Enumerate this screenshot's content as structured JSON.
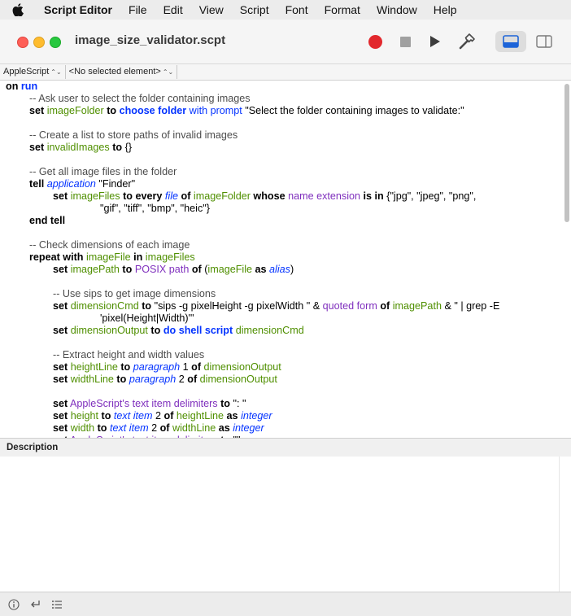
{
  "menubar": {
    "app_name": "Script Editor",
    "items": [
      "File",
      "Edit",
      "View",
      "Script",
      "Font",
      "Format",
      "Window",
      "Help"
    ]
  },
  "window": {
    "title": "image_size_validator.scpt"
  },
  "navbar": {
    "language": "AppleScript",
    "element": "<No selected element>"
  },
  "description": {
    "header": "Description",
    "text": ""
  },
  "code_lines": [
    {
      "indent": 0,
      "tokens": [
        {
          "t": "on",
          "c": "kw"
        },
        {
          "t": " "
        },
        {
          "t": "run",
          "c": "kwb"
        }
      ]
    },
    {
      "indent": 1,
      "tokens": [
        {
          "t": "-- Ask user to select the folder containing images",
          "c": "cmt"
        }
      ]
    },
    {
      "indent": 1,
      "tokens": [
        {
          "t": "set",
          "c": "kw"
        },
        {
          "t": " "
        },
        {
          "t": "imageFolder",
          "c": "var"
        },
        {
          "t": " "
        },
        {
          "t": "to",
          "c": "kw"
        },
        {
          "t": " "
        },
        {
          "t": "choose folder",
          "c": "kwb"
        },
        {
          "t": " "
        },
        {
          "t": "with prompt",
          "c": "cmd"
        },
        {
          "t": " \"Select the folder containing images to validate:\""
        }
      ]
    },
    {
      "indent": 0,
      "tokens": []
    },
    {
      "indent": 1,
      "tokens": [
        {
          "t": "-- Create a list to store paths of invalid images",
          "c": "cmt"
        }
      ]
    },
    {
      "indent": 1,
      "tokens": [
        {
          "t": "set",
          "c": "kw"
        },
        {
          "t": " "
        },
        {
          "t": "invalidImages",
          "c": "var"
        },
        {
          "t": " "
        },
        {
          "t": "to",
          "c": "kw"
        },
        {
          "t": " {}"
        }
      ]
    },
    {
      "indent": 0,
      "tokens": []
    },
    {
      "indent": 1,
      "tokens": [
        {
          "t": "-- Get all image files in the folder",
          "c": "cmt"
        }
      ]
    },
    {
      "indent": 1,
      "tokens": [
        {
          "t": "tell",
          "c": "kw"
        },
        {
          "t": " "
        },
        {
          "t": "application",
          "c": "cls"
        },
        {
          "t": " \"Finder\""
        }
      ]
    },
    {
      "indent": 2,
      "tokens": [
        {
          "t": "set",
          "c": "kw"
        },
        {
          "t": " "
        },
        {
          "t": "imageFiles",
          "c": "var"
        },
        {
          "t": " "
        },
        {
          "t": "to",
          "c": "kw"
        },
        {
          "t": " "
        },
        {
          "t": "every",
          "c": "kw"
        },
        {
          "t": " "
        },
        {
          "t": "file",
          "c": "cls"
        },
        {
          "t": " "
        },
        {
          "t": "of",
          "c": "kw"
        },
        {
          "t": " "
        },
        {
          "t": "imageFolder",
          "c": "var"
        },
        {
          "t": " "
        },
        {
          "t": "whose",
          "c": "kw"
        },
        {
          "t": " "
        },
        {
          "t": "name extension",
          "c": "prp"
        },
        {
          "t": " "
        },
        {
          "t": "is in",
          "c": "kw"
        },
        {
          "t": " {\"jpg\", \"jpeg\", \"png\","
        }
      ]
    },
    {
      "indent": 4,
      "tokens": [
        {
          "t": "\"gif\", \"tiff\", \"bmp\", \"heic\"}"
        }
      ]
    },
    {
      "indent": 1,
      "tokens": [
        {
          "t": "end tell",
          "c": "kw"
        }
      ]
    },
    {
      "indent": 0,
      "tokens": []
    },
    {
      "indent": 1,
      "tokens": [
        {
          "t": "-- Check dimensions of each image",
          "c": "cmt"
        }
      ]
    },
    {
      "indent": 1,
      "tokens": [
        {
          "t": "repeat with",
          "c": "kw"
        },
        {
          "t": " "
        },
        {
          "t": "imageFile",
          "c": "var"
        },
        {
          "t": " "
        },
        {
          "t": "in",
          "c": "kw"
        },
        {
          "t": " "
        },
        {
          "t": "imageFiles",
          "c": "var"
        }
      ]
    },
    {
      "indent": 2,
      "tokens": [
        {
          "t": "set",
          "c": "kw"
        },
        {
          "t": " "
        },
        {
          "t": "imagePath",
          "c": "var"
        },
        {
          "t": " "
        },
        {
          "t": "to",
          "c": "kw"
        },
        {
          "t": " "
        },
        {
          "t": "POSIX path",
          "c": "prp"
        },
        {
          "t": " "
        },
        {
          "t": "of",
          "c": "kw"
        },
        {
          "t": " ("
        },
        {
          "t": "imageFile",
          "c": "var"
        },
        {
          "t": " "
        },
        {
          "t": "as",
          "c": "kw"
        },
        {
          "t": " "
        },
        {
          "t": "alias",
          "c": "cls"
        },
        {
          "t": ")"
        }
      ]
    },
    {
      "indent": 0,
      "tokens": []
    },
    {
      "indent": 2,
      "tokens": [
        {
          "t": "-- Use sips to get image dimensions",
          "c": "cmt"
        }
      ]
    },
    {
      "indent": 2,
      "tokens": [
        {
          "t": "set",
          "c": "kw"
        },
        {
          "t": " "
        },
        {
          "t": "dimensionCmd",
          "c": "var"
        },
        {
          "t": " "
        },
        {
          "t": "to",
          "c": "kw"
        },
        {
          "t": " \"sips -g pixelHeight -g pixelWidth \" & "
        },
        {
          "t": "quoted form",
          "c": "prp"
        },
        {
          "t": " "
        },
        {
          "t": "of",
          "c": "kw"
        },
        {
          "t": " "
        },
        {
          "t": "imagePath",
          "c": "var"
        },
        {
          "t": " & \" | grep -E"
        }
      ]
    },
    {
      "indent": 4,
      "tokens": [
        {
          "t": "'pixel(Height|Width)'\""
        }
      ]
    },
    {
      "indent": 2,
      "tokens": [
        {
          "t": "set",
          "c": "kw"
        },
        {
          "t": " "
        },
        {
          "t": "dimensionOutput",
          "c": "var"
        },
        {
          "t": " "
        },
        {
          "t": "to",
          "c": "kw"
        },
        {
          "t": " "
        },
        {
          "t": "do shell script",
          "c": "kwb"
        },
        {
          "t": " "
        },
        {
          "t": "dimensionCmd",
          "c": "var"
        }
      ]
    },
    {
      "indent": 0,
      "tokens": []
    },
    {
      "indent": 2,
      "tokens": [
        {
          "t": "-- Extract height and width values",
          "c": "cmt"
        }
      ]
    },
    {
      "indent": 2,
      "tokens": [
        {
          "t": "set",
          "c": "kw"
        },
        {
          "t": " "
        },
        {
          "t": "heightLine",
          "c": "var"
        },
        {
          "t": " "
        },
        {
          "t": "to",
          "c": "kw"
        },
        {
          "t": " "
        },
        {
          "t": "paragraph",
          "c": "cls"
        },
        {
          "t": " 1 "
        },
        {
          "t": "of",
          "c": "kw"
        },
        {
          "t": " "
        },
        {
          "t": "dimensionOutput",
          "c": "var"
        }
      ]
    },
    {
      "indent": 2,
      "tokens": [
        {
          "t": "set",
          "c": "kw"
        },
        {
          "t": " "
        },
        {
          "t": "widthLine",
          "c": "var"
        },
        {
          "t": " "
        },
        {
          "t": "to",
          "c": "kw"
        },
        {
          "t": " "
        },
        {
          "t": "paragraph",
          "c": "cls"
        },
        {
          "t": " 2 "
        },
        {
          "t": "of",
          "c": "kw"
        },
        {
          "t": " "
        },
        {
          "t": "dimensionOutput",
          "c": "var"
        }
      ]
    },
    {
      "indent": 0,
      "tokens": []
    },
    {
      "indent": 2,
      "tokens": [
        {
          "t": "set",
          "c": "kw"
        },
        {
          "t": " "
        },
        {
          "t": "AppleScript's text item delimiters",
          "c": "prp"
        },
        {
          "t": " "
        },
        {
          "t": "to",
          "c": "kw"
        },
        {
          "t": " \": \""
        }
      ]
    },
    {
      "indent": 2,
      "tokens": [
        {
          "t": "set",
          "c": "kw"
        },
        {
          "t": " "
        },
        {
          "t": "height",
          "c": "var"
        },
        {
          "t": " "
        },
        {
          "t": "to",
          "c": "kw"
        },
        {
          "t": " "
        },
        {
          "t": "text item",
          "c": "cls"
        },
        {
          "t": " 2 "
        },
        {
          "t": "of",
          "c": "kw"
        },
        {
          "t": " "
        },
        {
          "t": "heightLine",
          "c": "var"
        },
        {
          "t": " "
        },
        {
          "t": "as",
          "c": "kw"
        },
        {
          "t": " "
        },
        {
          "t": "integer",
          "c": "cls"
        }
      ]
    },
    {
      "indent": 2,
      "tokens": [
        {
          "t": "set",
          "c": "kw"
        },
        {
          "t": " "
        },
        {
          "t": "width",
          "c": "var"
        },
        {
          "t": " "
        },
        {
          "t": "to",
          "c": "kw"
        },
        {
          "t": " "
        },
        {
          "t": "text item",
          "c": "cls"
        },
        {
          "t": " 2 "
        },
        {
          "t": "of",
          "c": "kw"
        },
        {
          "t": " "
        },
        {
          "t": "widthLine",
          "c": "var"
        },
        {
          "t": " "
        },
        {
          "t": "as",
          "c": "kw"
        },
        {
          "t": " "
        },
        {
          "t": "integer",
          "c": "cls"
        }
      ]
    },
    {
      "indent": 2,
      "tokens": [
        {
          "t": "set",
          "c": "kw"
        },
        {
          "t": " "
        },
        {
          "t": "AppleScript's text item delimiters",
          "c": "prp"
        },
        {
          "t": " "
        },
        {
          "t": "to",
          "c": "kw"
        },
        {
          "t": " \"\""
        }
      ]
    }
  ],
  "icons": {
    "apple": "apple-icon",
    "record": "record-icon",
    "stop": "stop-icon",
    "run": "run-icon",
    "compile": "hammer-icon",
    "show_log": "bottom-panel-icon",
    "show_sidebar": "sidebar-icon",
    "info": "info-icon",
    "reply": "reply-icon",
    "list": "list-icon"
  },
  "colors": {
    "keyword": "#000000",
    "command": "#0433ff",
    "variable": "#4f8f00",
    "property": "#7f2fbd",
    "comment": "#4c4c4c",
    "record_button": "#e2282d"
  }
}
